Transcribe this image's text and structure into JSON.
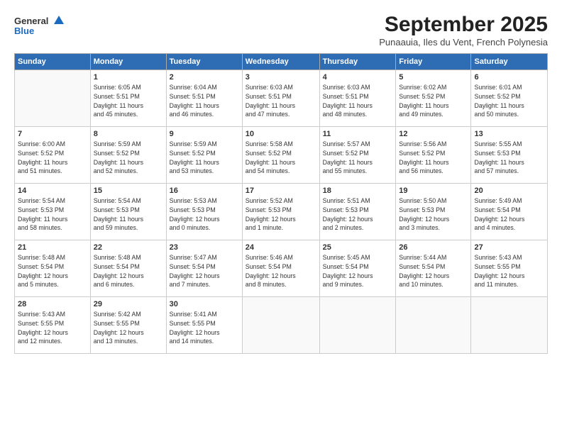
{
  "header": {
    "logo_line1": "General",
    "logo_line2": "Blue",
    "month": "September 2025",
    "location": "Punaauia, Iles du Vent, French Polynesia"
  },
  "days_of_week": [
    "Sunday",
    "Monday",
    "Tuesday",
    "Wednesday",
    "Thursday",
    "Friday",
    "Saturday"
  ],
  "weeks": [
    [
      {
        "day": "",
        "info": ""
      },
      {
        "day": "1",
        "info": "Sunrise: 6:05 AM\nSunset: 5:51 PM\nDaylight: 11 hours\nand 45 minutes."
      },
      {
        "day": "2",
        "info": "Sunrise: 6:04 AM\nSunset: 5:51 PM\nDaylight: 11 hours\nand 46 minutes."
      },
      {
        "day": "3",
        "info": "Sunrise: 6:03 AM\nSunset: 5:51 PM\nDaylight: 11 hours\nand 47 minutes."
      },
      {
        "day": "4",
        "info": "Sunrise: 6:03 AM\nSunset: 5:51 PM\nDaylight: 11 hours\nand 48 minutes."
      },
      {
        "day": "5",
        "info": "Sunrise: 6:02 AM\nSunset: 5:52 PM\nDaylight: 11 hours\nand 49 minutes."
      },
      {
        "day": "6",
        "info": "Sunrise: 6:01 AM\nSunset: 5:52 PM\nDaylight: 11 hours\nand 50 minutes."
      }
    ],
    [
      {
        "day": "7",
        "info": "Sunrise: 6:00 AM\nSunset: 5:52 PM\nDaylight: 11 hours\nand 51 minutes."
      },
      {
        "day": "8",
        "info": "Sunrise: 5:59 AM\nSunset: 5:52 PM\nDaylight: 11 hours\nand 52 minutes."
      },
      {
        "day": "9",
        "info": "Sunrise: 5:59 AM\nSunset: 5:52 PM\nDaylight: 11 hours\nand 53 minutes."
      },
      {
        "day": "10",
        "info": "Sunrise: 5:58 AM\nSunset: 5:52 PM\nDaylight: 11 hours\nand 54 minutes."
      },
      {
        "day": "11",
        "info": "Sunrise: 5:57 AM\nSunset: 5:52 PM\nDaylight: 11 hours\nand 55 minutes."
      },
      {
        "day": "12",
        "info": "Sunrise: 5:56 AM\nSunset: 5:52 PM\nDaylight: 11 hours\nand 56 minutes."
      },
      {
        "day": "13",
        "info": "Sunrise: 5:55 AM\nSunset: 5:53 PM\nDaylight: 11 hours\nand 57 minutes."
      }
    ],
    [
      {
        "day": "14",
        "info": "Sunrise: 5:54 AM\nSunset: 5:53 PM\nDaylight: 11 hours\nand 58 minutes."
      },
      {
        "day": "15",
        "info": "Sunrise: 5:54 AM\nSunset: 5:53 PM\nDaylight: 11 hours\nand 59 minutes."
      },
      {
        "day": "16",
        "info": "Sunrise: 5:53 AM\nSunset: 5:53 PM\nDaylight: 12 hours\nand 0 minutes."
      },
      {
        "day": "17",
        "info": "Sunrise: 5:52 AM\nSunset: 5:53 PM\nDaylight: 12 hours\nand 1 minute."
      },
      {
        "day": "18",
        "info": "Sunrise: 5:51 AM\nSunset: 5:53 PM\nDaylight: 12 hours\nand 2 minutes."
      },
      {
        "day": "19",
        "info": "Sunrise: 5:50 AM\nSunset: 5:53 PM\nDaylight: 12 hours\nand 3 minutes."
      },
      {
        "day": "20",
        "info": "Sunrise: 5:49 AM\nSunset: 5:54 PM\nDaylight: 12 hours\nand 4 minutes."
      }
    ],
    [
      {
        "day": "21",
        "info": "Sunrise: 5:48 AM\nSunset: 5:54 PM\nDaylight: 12 hours\nand 5 minutes."
      },
      {
        "day": "22",
        "info": "Sunrise: 5:48 AM\nSunset: 5:54 PM\nDaylight: 12 hours\nand 6 minutes."
      },
      {
        "day": "23",
        "info": "Sunrise: 5:47 AM\nSunset: 5:54 PM\nDaylight: 12 hours\nand 7 minutes."
      },
      {
        "day": "24",
        "info": "Sunrise: 5:46 AM\nSunset: 5:54 PM\nDaylight: 12 hours\nand 8 minutes."
      },
      {
        "day": "25",
        "info": "Sunrise: 5:45 AM\nSunset: 5:54 PM\nDaylight: 12 hours\nand 9 minutes."
      },
      {
        "day": "26",
        "info": "Sunrise: 5:44 AM\nSunset: 5:54 PM\nDaylight: 12 hours\nand 10 minutes."
      },
      {
        "day": "27",
        "info": "Sunrise: 5:43 AM\nSunset: 5:55 PM\nDaylight: 12 hours\nand 11 minutes."
      }
    ],
    [
      {
        "day": "28",
        "info": "Sunrise: 5:43 AM\nSunset: 5:55 PM\nDaylight: 12 hours\nand 12 minutes."
      },
      {
        "day": "29",
        "info": "Sunrise: 5:42 AM\nSunset: 5:55 PM\nDaylight: 12 hours\nand 13 minutes."
      },
      {
        "day": "30",
        "info": "Sunrise: 5:41 AM\nSunset: 5:55 PM\nDaylight: 12 hours\nand 14 minutes."
      },
      {
        "day": "",
        "info": ""
      },
      {
        "day": "",
        "info": ""
      },
      {
        "day": "",
        "info": ""
      },
      {
        "day": "",
        "info": ""
      }
    ]
  ]
}
